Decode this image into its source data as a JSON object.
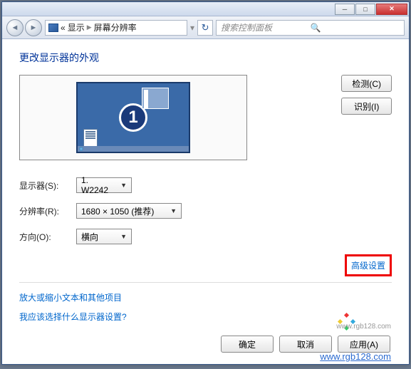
{
  "window": {
    "minimize_glyph": "─",
    "maximize_glyph": "□",
    "close_glyph": "✕"
  },
  "nav": {
    "back_glyph": "◄",
    "forward_glyph": "►",
    "breadcrumb_start": "«",
    "breadcrumb_item1": "显示",
    "breadcrumb_item2": "屏幕分辨率",
    "refresh_glyph": "↻",
    "search_placeholder": "搜索控制面板",
    "search_glyph": "🔍"
  },
  "content": {
    "title": "更改显示器的外观",
    "monitor_number": "1",
    "detect_btn": "检测(C)",
    "identify_btn": "识别(I)",
    "display_label": "显示器(S):",
    "display_value": "1. W2242",
    "resolution_label": "分辨率(R):",
    "resolution_value": "1680 × 1050 (推荐)",
    "orientation_label": "方向(O):",
    "orientation_value": "横向",
    "advanced_link": "高级设置",
    "link_text_size": "放大或缩小文本和其他项目",
    "link_which_display": "我应该选择什么显示器设置?",
    "ok_btn": "确定",
    "cancel_btn": "取消",
    "apply_btn": "应用(A)"
  },
  "watermark": {
    "small": "www.rgb128.com",
    "large": "www.rgb128.com"
  }
}
